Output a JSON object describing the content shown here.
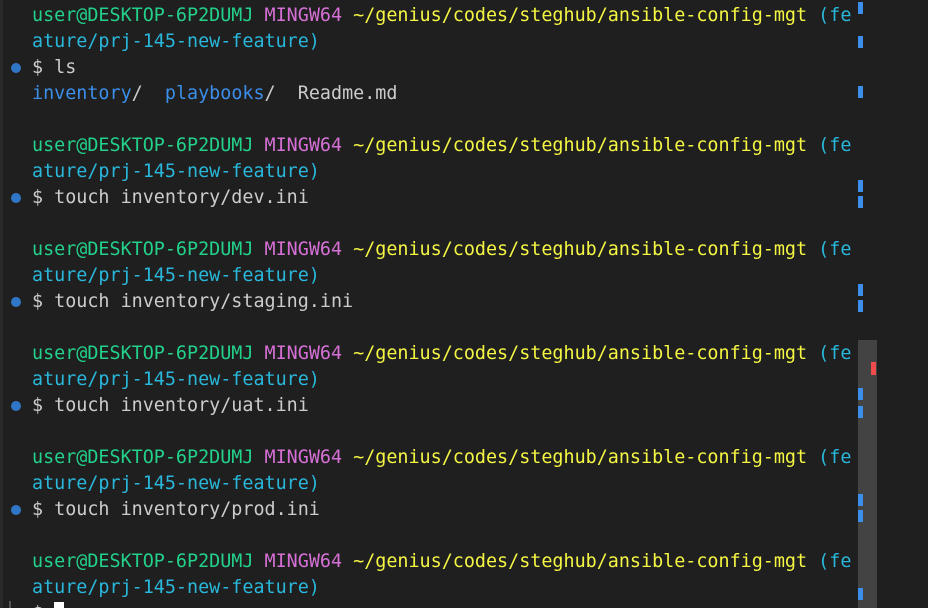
{
  "terminal": {
    "lines": [
      {
        "type": "prompt1",
        "user": "user@DESKTOP-6P2DUMJ",
        "env": "MINGW64",
        "path": "~/genius/codes/steghub/ansible-config-mgt",
        "branch_start": "(fe"
      },
      {
        "type": "prompt2",
        "branch_end": "ature/prj-145-new-feature)"
      },
      {
        "type": "cmd",
        "text": "$ ls"
      },
      {
        "type": "output",
        "dir1": "inventory",
        "slash1": "/",
        "dir2": "playbooks",
        "slash2": "/",
        "file1": "Readme.md"
      },
      {
        "type": "blank"
      },
      {
        "type": "prompt1",
        "user": "user@DESKTOP-6P2DUMJ",
        "env": "MINGW64",
        "path": "~/genius/codes/steghub/ansible-config-mgt",
        "branch_start": "(fe"
      },
      {
        "type": "prompt2",
        "branch_end": "ature/prj-145-new-feature)"
      },
      {
        "type": "cmd",
        "text": "$ touch inventory/dev.ini"
      },
      {
        "type": "blank"
      },
      {
        "type": "prompt1",
        "user": "user@DESKTOP-6P2DUMJ",
        "env": "MINGW64",
        "path": "~/genius/codes/steghub/ansible-config-mgt",
        "branch_start": "(fe"
      },
      {
        "type": "prompt2",
        "branch_end": "ature/prj-145-new-feature)"
      },
      {
        "type": "cmd",
        "text": "$ touch inventory/staging.ini"
      },
      {
        "type": "blank"
      },
      {
        "type": "prompt1",
        "user": "user@DESKTOP-6P2DUMJ",
        "env": "MINGW64",
        "path": "~/genius/codes/steghub/ansible-config-mgt",
        "branch_start": "(fe"
      },
      {
        "type": "prompt2",
        "branch_end": "ature/prj-145-new-feature)"
      },
      {
        "type": "cmd",
        "text": "$ touch inventory/uat.ini"
      },
      {
        "type": "blank"
      },
      {
        "type": "prompt1",
        "user": "user@DESKTOP-6P2DUMJ",
        "env": "MINGW64",
        "path": "~/genius/codes/steghub/ansible-config-mgt",
        "branch_start": "(fe"
      },
      {
        "type": "prompt2",
        "branch_end": "ature/prj-145-new-feature)"
      },
      {
        "type": "cmd",
        "text": "$ touch inventory/prod.ini"
      },
      {
        "type": "blank"
      },
      {
        "type": "prompt1",
        "user": "user@DESKTOP-6P2DUMJ",
        "env": "MINGW64",
        "path": "~/genius/codes/steghub/ansible-config-mgt",
        "branch_start": "(fe"
      },
      {
        "type": "prompt2",
        "branch_end": "ature/prj-145-new-feature)"
      },
      {
        "type": "input",
        "text": "$ "
      }
    ]
  },
  "colors": {
    "background": "#1f1f1f",
    "user": "#23d18b",
    "env": "#d670d6",
    "path": "#f5f543",
    "branch": "#29b8db",
    "directory": "#3b8eea",
    "text": "#cccccc",
    "decoration": "#3794ff",
    "ruler_error": "#f14c4c"
  },
  "icons": {
    "command_decoration": "command-success-dot-icon",
    "cursor": "cursor-block"
  }
}
